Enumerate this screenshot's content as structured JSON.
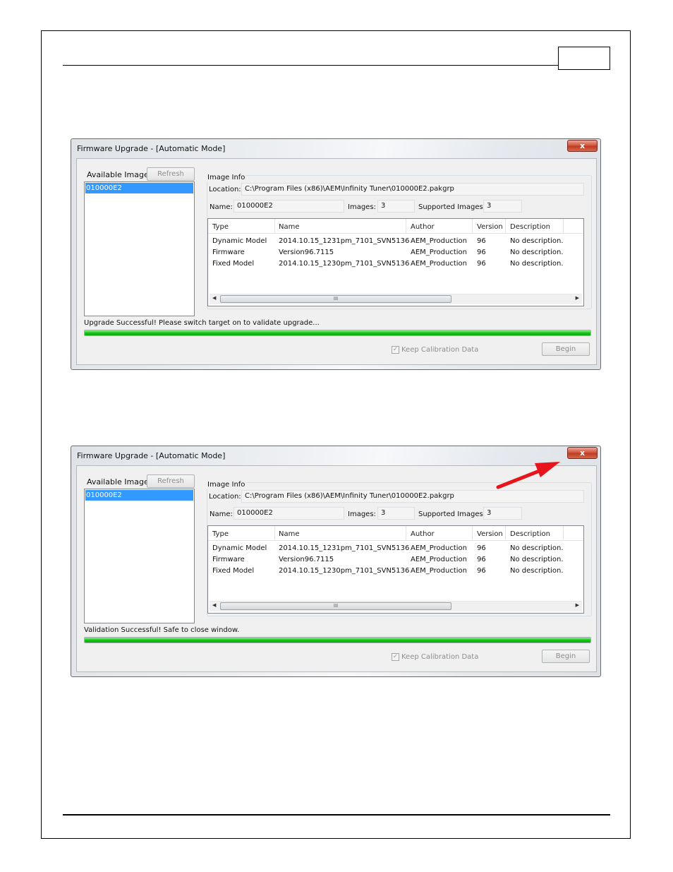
{
  "dialogs": [
    {
      "title": "Firmware Upgrade - [Automatic Mode]",
      "close_label": "x",
      "available_images_label": "Available Images",
      "refresh_label": "Refresh",
      "list_items": [
        "010000E2"
      ],
      "image_info_label": "Image Info",
      "location_label": "Location:",
      "location_value": "C:\\Program Files (x86)\\AEM\\Infinity Tuner\\010000E2.pakgrp",
      "name_label": "Name:",
      "name_value": "010000E2",
      "images_label": "Images:",
      "images_value": "3",
      "supported_images_label": "Supported Images:",
      "supported_images_value": "3",
      "columns": [
        "Type",
        "Name",
        "Author",
        "Version",
        "Description"
      ],
      "rows": [
        [
          "Dynamic Model",
          "2014.10.15_1231pm_7101_SVN5136",
          "AEM_Production",
          "96",
          "No description."
        ],
        [
          "Firmware",
          "Version96.7115",
          "AEM_Production",
          "96",
          "No description."
        ],
        [
          "Fixed Model",
          "2014.10.15_1230pm_7101_SVN5136",
          "AEM_Production",
          "96",
          "No description."
        ]
      ],
      "scroll_thumb_label": "III",
      "status_text": "Upgrade Successful!  Please switch target on to validate upgrade...",
      "progress": 1.0,
      "keep_calibration_label": "Keep Calibration Data",
      "keep_calibration_checked": true,
      "begin_label": "Begin"
    },
    {
      "title": "Firmware Upgrade - [Automatic Mode]",
      "close_label": "x",
      "available_images_label": "Available Images",
      "refresh_label": "Refresh",
      "list_items": [
        "010000E2"
      ],
      "image_info_label": "Image Info",
      "location_label": "Location:",
      "location_value": "C:\\Program Files (x86)\\AEM\\Infinity Tuner\\010000E2.pakgrp",
      "name_label": "Name:",
      "name_value": "010000E2",
      "images_label": "Images:",
      "images_value": "3",
      "supported_images_label": "Supported Images:",
      "supported_images_value": "3",
      "columns": [
        "Type",
        "Name",
        "Author",
        "Version",
        "Description"
      ],
      "rows": [
        [
          "Dynamic Model",
          "2014.10.15_1231pm_7101_SVN5136",
          "AEM_Production",
          "96",
          "No description."
        ],
        [
          "Firmware",
          "Version96.7115",
          "AEM_Production",
          "96",
          "No description."
        ],
        [
          "Fixed Model",
          "2014.10.15_1230pm_7101_SVN5136",
          "AEM_Production",
          "96",
          "No description."
        ]
      ],
      "scroll_thumb_label": "III",
      "status_text": "Validation Successful!  Safe to close window.",
      "progress": 1.0,
      "keep_calibration_label": "Keep Calibration Data",
      "keep_calibration_checked": true,
      "begin_label": "Begin"
    }
  ],
  "annotation": {
    "arrow_color": "#e8141b",
    "points_to": "close-button"
  },
  "icons": {
    "checkmark": "check-icon",
    "scroll_left": "scroll-left-icon",
    "scroll_right": "scroll-right-icon"
  }
}
